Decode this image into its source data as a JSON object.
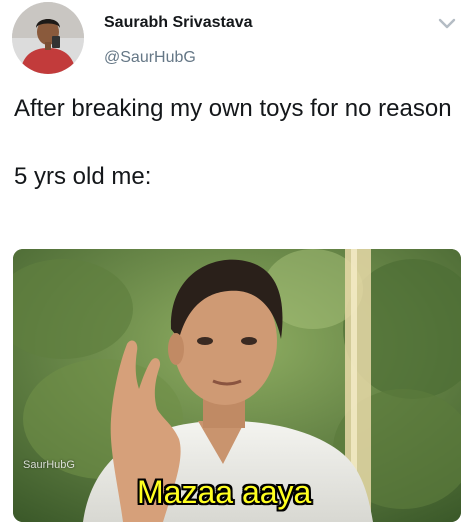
{
  "author": {
    "name": "Saurabh Srivastava",
    "handle": "@SaurHubG"
  },
  "tweet": {
    "line1": "After breaking my own toys for no reason",
    "line2": "5 yrs old me:"
  },
  "media": {
    "watermark": "SaurHubG",
    "subtitle": "Mazaa aaya"
  },
  "icons": {
    "menu": "chevron-down-icon"
  },
  "colors": {
    "text": "#14171a",
    "handle": "#657786",
    "subtitle": "#ffff20"
  }
}
